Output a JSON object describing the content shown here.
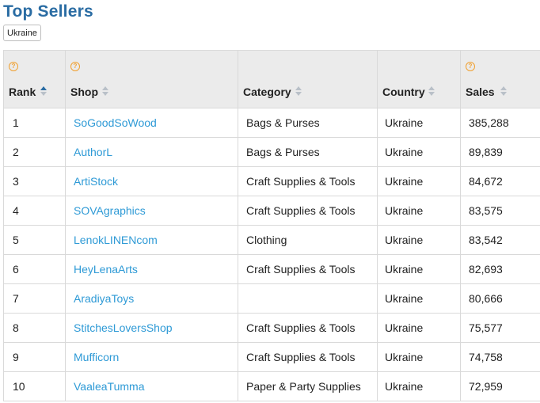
{
  "title": "Top Sellers",
  "filter_tag": "Ukraine",
  "columns": [
    {
      "label": "Rank",
      "help": true,
      "sort": "asc"
    },
    {
      "label": "Shop",
      "help": true,
      "sort": "none"
    },
    {
      "label": "Category",
      "help": false,
      "sort": "none"
    },
    {
      "label": "Country",
      "help": false,
      "sort": "none"
    },
    {
      "label": "Sales",
      "help": true,
      "sort": "none"
    }
  ],
  "help_glyph": "?",
  "rows": [
    {
      "rank": "1",
      "shop": "SoGoodSoWood",
      "category": "Bags & Purses",
      "country": "Ukraine",
      "sales": "385,288"
    },
    {
      "rank": "2",
      "shop": "AuthorL",
      "category": "Bags & Purses",
      "country": "Ukraine",
      "sales": "89,839"
    },
    {
      "rank": "3",
      "shop": "ArtiStock",
      "category": "Craft Supplies & Tools",
      "country": "Ukraine",
      "sales": "84,672"
    },
    {
      "rank": "4",
      "shop": "SOVAgraphics",
      "category": "Craft Supplies & Tools",
      "country": "Ukraine",
      "sales": "83,575"
    },
    {
      "rank": "5",
      "shop": "LenokLINENcom",
      "category": "Clothing",
      "country": "Ukraine",
      "sales": "83,542"
    },
    {
      "rank": "6",
      "shop": "HeyLenaArts",
      "category": "Craft Supplies & Tools",
      "country": "Ukraine",
      "sales": "82,693"
    },
    {
      "rank": "7",
      "shop": "AradiyaToys",
      "category": "",
      "country": "Ukraine",
      "sales": "80,666"
    },
    {
      "rank": "8",
      "shop": "StitchesLoversShop",
      "category": "Craft Supplies & Tools",
      "country": "Ukraine",
      "sales": "75,577"
    },
    {
      "rank": "9",
      "shop": "Mufficorn",
      "category": "Craft Supplies & Tools",
      "country": "Ukraine",
      "sales": "74,758"
    },
    {
      "rank": "10",
      "shop": "VaaleaTumma",
      "category": "Paper & Party Supplies",
      "country": "Ukraine",
      "sales": "72,959"
    }
  ],
  "colors": {
    "title": "#2a6ca3",
    "link": "#2e9ad6",
    "help": "#f0a030",
    "header_bg": "#ebebeb"
  },
  "icons": {
    "help": "question-circle-icon",
    "sort": "sort-arrows-icon"
  }
}
